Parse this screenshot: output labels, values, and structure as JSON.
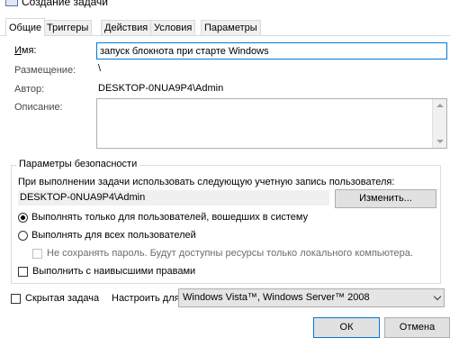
{
  "window": {
    "title": "Создание задачи"
  },
  "tabs": [
    {
      "label": "Общие"
    },
    {
      "label": "Триггеры"
    },
    {
      "label": "Действия"
    },
    {
      "label": "Условия"
    },
    {
      "label": "Параметры"
    }
  ],
  "general": {
    "name_label": "Имя:",
    "name_value": "запуск блокнота при старте Windows",
    "location_label": "Размещение:",
    "location_value": "\\",
    "author_label": "Автор:",
    "author_value": "DESKTOP-0NUA9P4\\Admin",
    "description_label": "Описание:",
    "description_value": ""
  },
  "security": {
    "group_title": "Параметры безопасности",
    "account_prompt": "При выполнении задачи использовать следующую учетную запись пользователя:",
    "account_value": "DESKTOP-0NUA9P4\\Admin",
    "change_button": "Изменить...",
    "radio_logged_on": {
      "label": "Выполнять только для пользователей, вошедших в систему",
      "checked": true
    },
    "radio_all_users": {
      "label": "Выполнять для всех пользователей",
      "checked": false
    },
    "dont_store_password": {
      "label": "Не сохранять пароль. Будут доступны ресурсы только локального компьютера.",
      "checked": false,
      "enabled": false
    },
    "highest_privileges": {
      "label": "Выполнить с наивысшими правами",
      "checked": false
    }
  },
  "bottom": {
    "hidden_task_label": "Скрытая задача",
    "configure_label": "Настроить для:",
    "configure_value": "Windows Vista™, Windows Server™ 2008"
  },
  "buttons": {
    "ok": "ОК",
    "cancel": "Отмена"
  }
}
